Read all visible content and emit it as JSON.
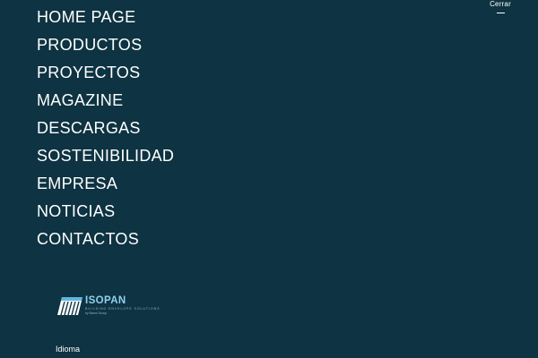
{
  "header": {
    "close_label": "Cerrar"
  },
  "menu": {
    "items": [
      {
        "label": "HOME PAGE"
      },
      {
        "label": "PRODUCTOS"
      },
      {
        "label": "PROYECTOS"
      },
      {
        "label": "MAGAZINE"
      },
      {
        "label": "DESCARGAS"
      },
      {
        "label": "SOSTENIBILIDAD"
      },
      {
        "label": "EMPRESA"
      },
      {
        "label": "NOTICIAS"
      },
      {
        "label": "CONTACTOS"
      }
    ]
  },
  "logo": {
    "name": "ISOPAN",
    "tagline": "BUILDING ENVELOPE SOLUTIONS",
    "group": "by Manni Group"
  },
  "language": {
    "label": "Idioma"
  },
  "colors": {
    "background": "#0e3342",
    "text": "#ffffff",
    "logo_accent": "#8fd0ee"
  }
}
